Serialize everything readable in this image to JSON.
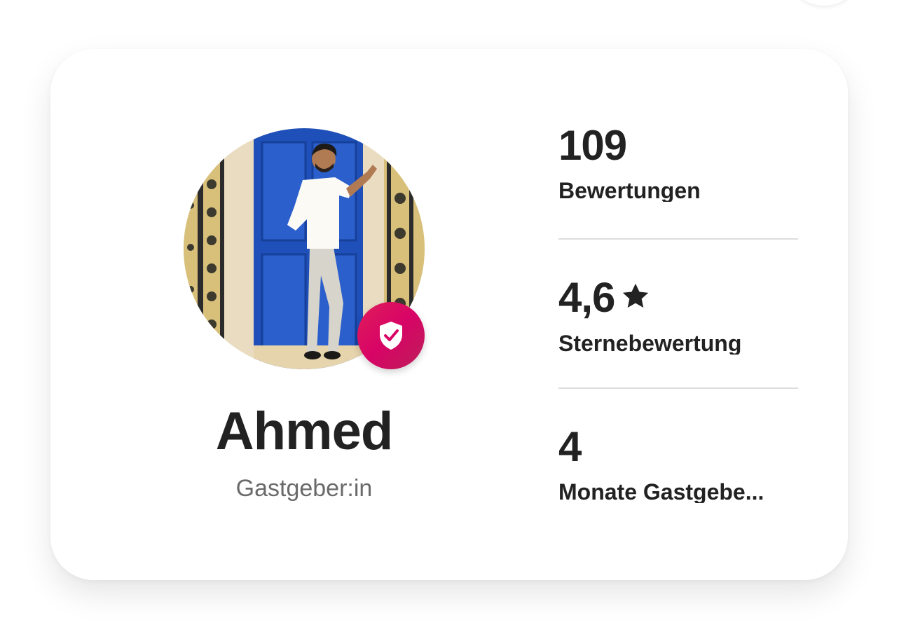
{
  "host": {
    "name": "Ahmed",
    "role": "Gastgeber:in",
    "verified": true
  },
  "stats": [
    {
      "value": "109",
      "label": "Bewertungen"
    },
    {
      "value": "4,6",
      "label": "Sternebewertung",
      "icon": "star-icon"
    },
    {
      "value": "4",
      "label": "Monate Gastgebe..."
    }
  ],
  "colors": {
    "accent": "#d70466",
    "text": "#222222",
    "muted": "#6a6a6a",
    "divider": "#dddddd"
  }
}
